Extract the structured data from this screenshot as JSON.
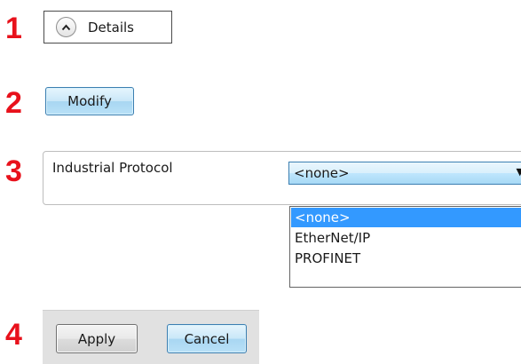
{
  "steps": [
    "1",
    "2",
    "3",
    "4"
  ],
  "details": {
    "label": "Details",
    "icon": "chevron-up-icon"
  },
  "modify_button": {
    "label": "Modify"
  },
  "protocol": {
    "label": "Industrial Protocol",
    "selected": "<none>",
    "options": [
      "<none>",
      "EtherNet/IP",
      "PROFINET"
    ]
  },
  "footer": {
    "apply_label": "Apply",
    "cancel_label": "Cancel"
  },
  "colors": {
    "step_number": "#e8111b",
    "button_blue": "#bfe2f7",
    "button_blue_border": "#3c7fb1",
    "selection": "#3399ff",
    "footer_bar": "#e1e1e1"
  }
}
